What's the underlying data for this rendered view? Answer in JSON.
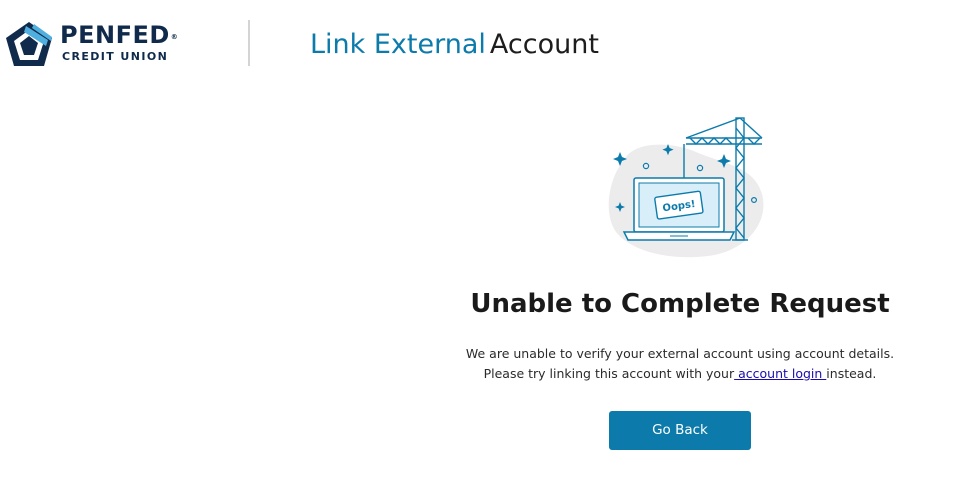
{
  "brand": {
    "name": "PENFED",
    "registered_mark": "®",
    "subtitle": "CREDIT UNION",
    "colors": {
      "navy": "#0f2a4a",
      "blue": "#0c7bab",
      "light_blue": "#4fb0e0"
    }
  },
  "header": {
    "title_part1": "Link External",
    "title_part2": "Account"
  },
  "illustration": {
    "icon": "error-construction-illustration",
    "sign_text": "Oops!"
  },
  "error": {
    "heading": "Unable to Complete Request",
    "line1": "We are unable to verify your external account using account details.",
    "line2_prefix": "Please try linking this account with your",
    "line2_link": " account login ",
    "line2_suffix": "instead."
  },
  "actions": {
    "go_back_label": "Go Back"
  }
}
